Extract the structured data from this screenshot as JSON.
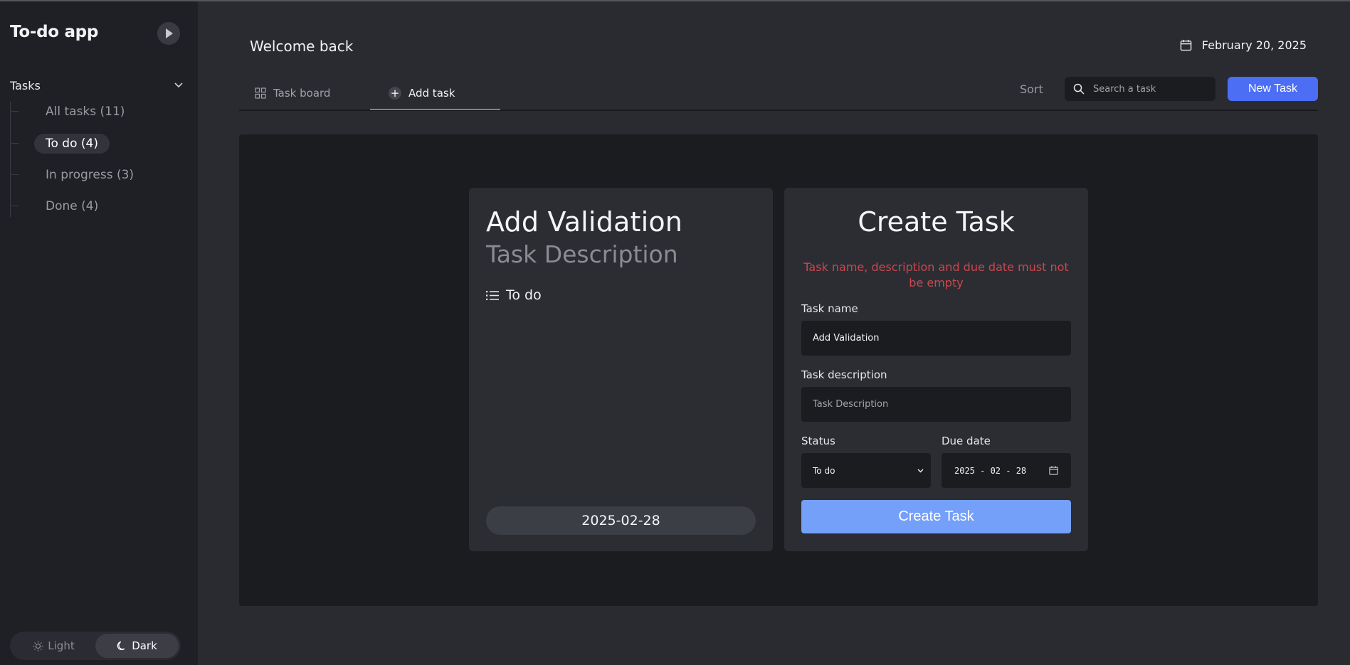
{
  "app": {
    "title": "To-do app"
  },
  "sidebar": {
    "section_label": "Tasks",
    "items": [
      {
        "label": "All tasks (11)"
      },
      {
        "label": "To do (4)"
      },
      {
        "label": "In progress (3)"
      },
      {
        "label": "Done (4)"
      }
    ],
    "theme": {
      "light_label": "Light",
      "dark_label": "Dark",
      "selected": "Dark"
    }
  },
  "header": {
    "welcome": "Welcome back",
    "date": "February 20, 2025"
  },
  "tabs": [
    {
      "label": "Task board",
      "icon": "grid-icon"
    },
    {
      "label": "Add task",
      "icon": "plus-circle-icon"
    }
  ],
  "toolbar": {
    "sort_label": "Sort",
    "search_placeholder": "Search a task",
    "new_task_label": "New Task"
  },
  "preview": {
    "title": "Add Validation",
    "description": "Task Description",
    "status": "To do",
    "due_date": "2025-02-28"
  },
  "form": {
    "title": "Create Task",
    "error": "Task name, description and due date must not be empty",
    "name_label": "Task name",
    "name_value": "Add Validation",
    "description_label": "Task description",
    "description_placeholder": "Task Description",
    "status_label": "Status",
    "status_value": "To do",
    "due_label": "Due date",
    "due_value": "2025 - 02 - 28",
    "submit_label": "Create Task"
  },
  "colors": {
    "accent": "#4c6ef5",
    "submit": "#74a0fa",
    "error": "#c9484e",
    "background": "#2a2b31",
    "sidebar": "#1f2025"
  }
}
